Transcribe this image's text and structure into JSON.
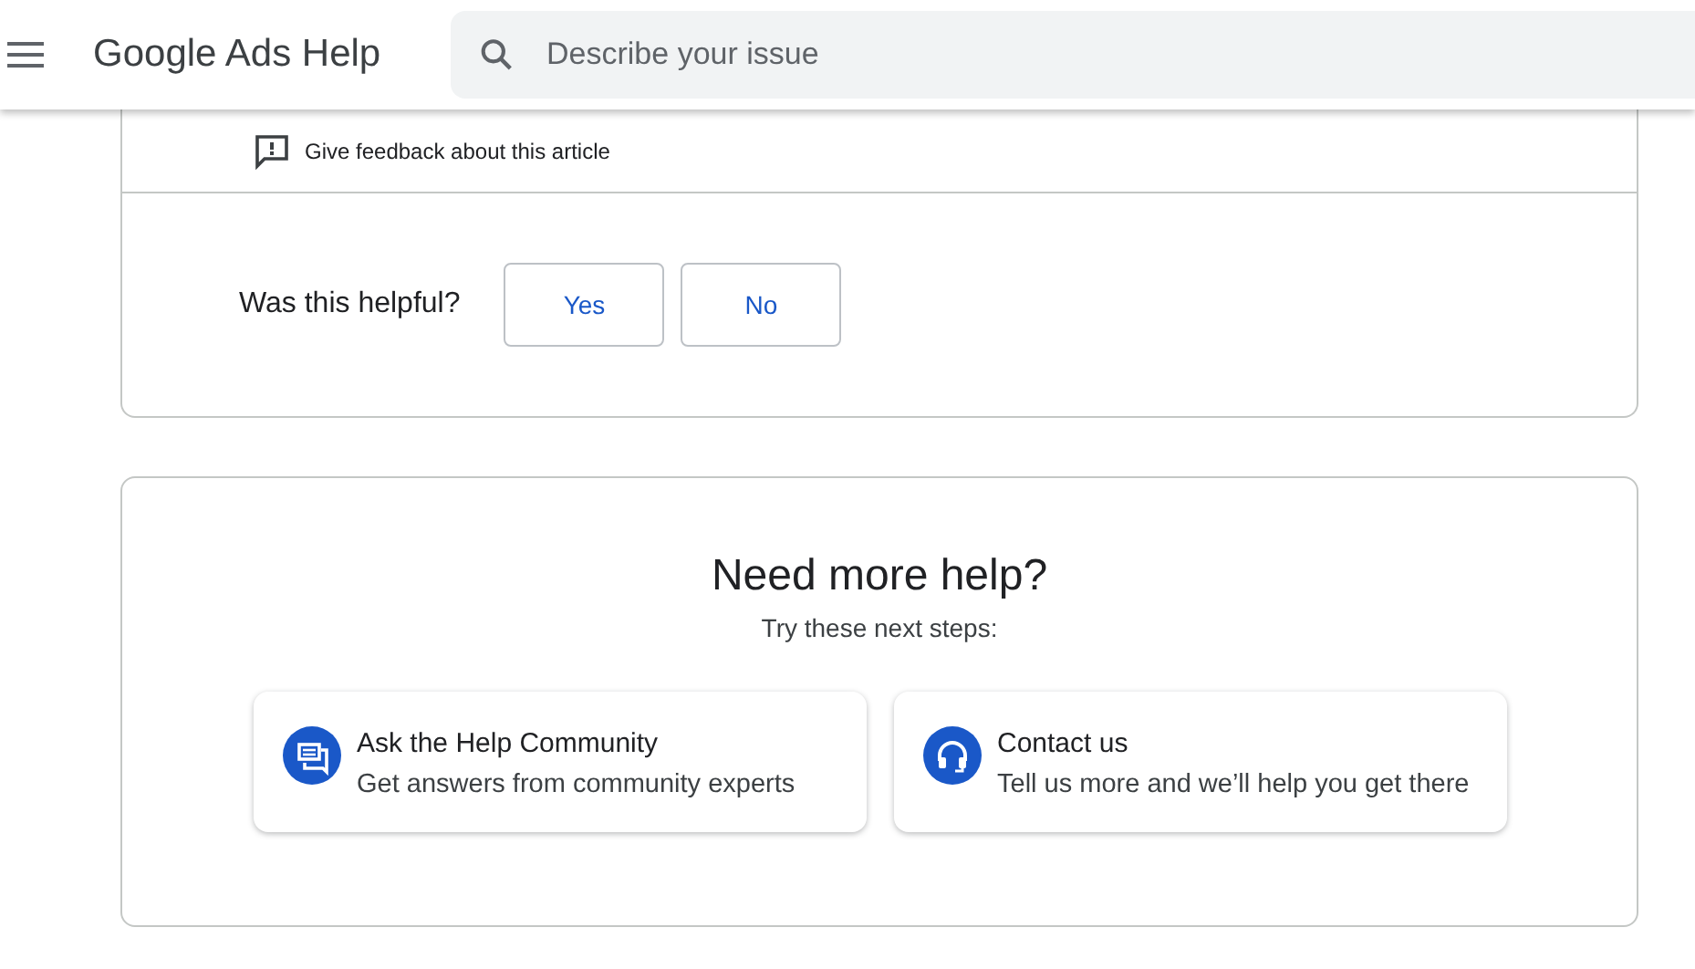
{
  "header": {
    "title": "Google Ads Help",
    "search": {
      "placeholder": "Describe your issue"
    }
  },
  "article_footer": {
    "feedback_link": "Give feedback about this article",
    "helpful": {
      "question": "Was this helpful?",
      "buttons": [
        "Yes",
        "No"
      ]
    }
  },
  "more_help": {
    "title": "Need more help?",
    "subtitle": "Try these next steps:",
    "options": [
      {
        "kind": "community",
        "title": "Ask the Help Community",
        "description": "Get answers from community experts"
      },
      {
        "kind": "contact",
        "title": "Contact us",
        "description": "Tell us more and we’ll help you get there"
      }
    ]
  }
}
